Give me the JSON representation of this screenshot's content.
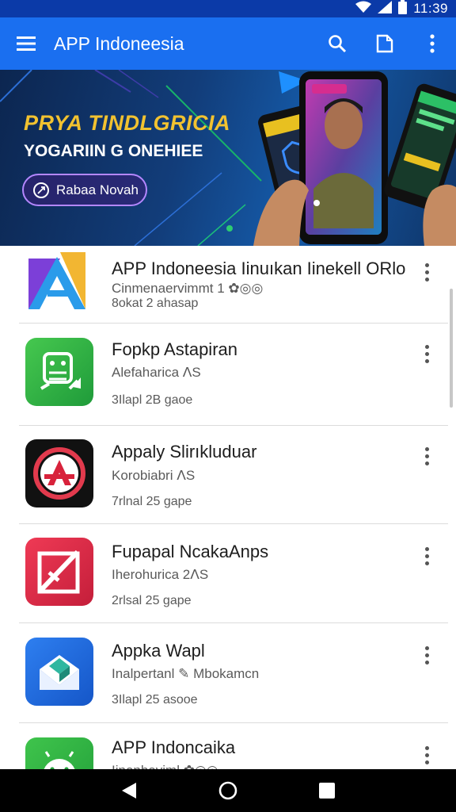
{
  "status_bar": {
    "time": "11:39"
  },
  "app_bar": {
    "title": "APP Indoneesia",
    "icons": {
      "menu": "menu-icon",
      "search": "search-icon",
      "bookmark": "bookmark-icon",
      "more": "more-vert-icon"
    },
    "color": "#1a6ff0"
  },
  "banner": {
    "headline": "PRYA TINDLGRICIA",
    "subheadline": "YOGARIIN G ONEHIEE",
    "button_label": "Rabaa Novah",
    "headline_color": "#f2c230",
    "button_border_color": "#b487ff"
  },
  "apps": [
    {
      "name": "APP Indoneesia  Iinuıkan Iinekell ORlo",
      "subtitle": "Cinmenaervimmt 1 ✿◎◎",
      "meta": "8okat 2 ahasap",
      "icon": "letter-a-icon"
    },
    {
      "name": "Fopkp Astapiran",
      "subtitle": "Alefaharica ᐱS",
      "meta": "3Ilapl 2B gaoe",
      "icon": "android-arrows-icon"
    },
    {
      "name": "Appaly Slirıkluduar",
      "subtitle": "Korobiabri ᐱS",
      "meta": "7rlnal 25 gape",
      "icon": "circle-a-icon"
    },
    {
      "name": "Fupapal NcakaAnps",
      "subtitle": "Iherohurica 2ᐱS",
      "meta": "2rlsal 25 gape",
      "icon": "check-frame-icon"
    },
    {
      "name": "Appka Wapl",
      "subtitle": "Inalpertanl ✎ Mbokamcn",
      "meta": "3Ilapl 25 asooe",
      "icon": "envelope-cube-icon"
    },
    {
      "name": "APP Indoncaika",
      "subtitle": "Iinonbaviml ✿◎◎",
      "meta": "",
      "icon": "android-icon"
    }
  ],
  "nav": {
    "icons": [
      "back-icon",
      "home-icon",
      "recents-icon"
    ]
  }
}
